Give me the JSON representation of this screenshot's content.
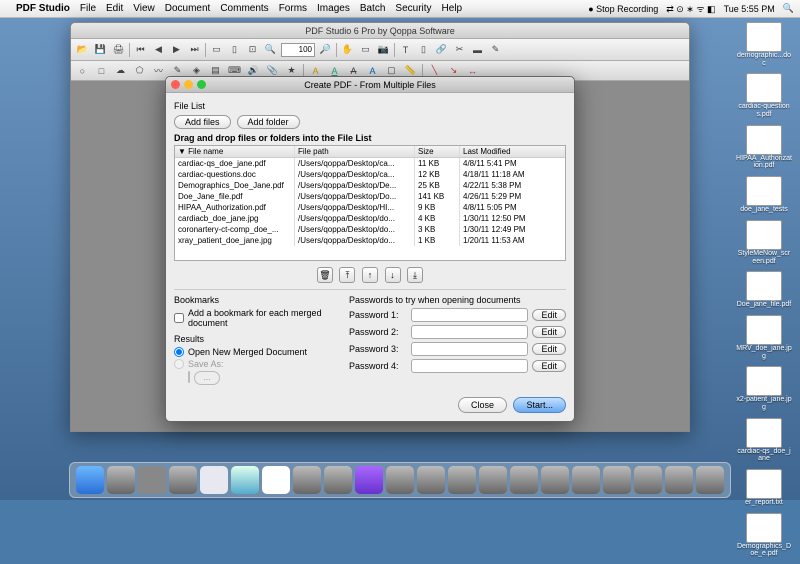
{
  "menubar": {
    "apple": "",
    "app": "PDF Studio",
    "items": [
      "File",
      "Edit",
      "View",
      "Document",
      "Comments",
      "Forms",
      "Images",
      "Batch",
      "Security",
      "Help"
    ],
    "stop_recording": "Stop Recording",
    "time": "Tue 5:55 PM"
  },
  "appwin": {
    "title": "PDF Studio 6 Pro by Qoppa Software",
    "zoom": "100"
  },
  "dialog": {
    "title": "Create PDF - From Multiple Files",
    "file_list_label": "File List",
    "add_files": "Add files",
    "add_folder": "Add folder",
    "drag_hint": "Drag and drop files or folders into the File List",
    "cols": [
      "File name",
      "File path",
      "Size",
      "Last Modified"
    ],
    "rows": [
      {
        "name": "cardiac-qs_doe_jane.pdf",
        "path": "/Users/qoppa/Desktop/ca...",
        "size": "11 KB",
        "mod": "4/8/11 5:41 PM"
      },
      {
        "name": "cardiac-questions.doc",
        "path": "/Users/qoppa/Desktop/ca...",
        "size": "12 KB",
        "mod": "4/18/11 11:18 AM"
      },
      {
        "name": "Demographics_Doe_Jane.pdf",
        "path": "/Users/qoppa/Desktop/De...",
        "size": "25 KB",
        "mod": "4/22/11 5:38 PM"
      },
      {
        "name": "Doe_Jane_file.pdf",
        "path": "/Users/qoppa/Desktop/Do...",
        "size": "141 KB",
        "mod": "4/26/11 5:29 PM"
      },
      {
        "name": "HIPAA_Authorization.pdf",
        "path": "/Users/qoppa/Desktop/HI...",
        "size": "9 KB",
        "mod": "4/8/11 5:05 PM"
      },
      {
        "name": "cardiacb_doe_jane.jpg",
        "path": "/Users/qoppa/Desktop/do...",
        "size": "4 KB",
        "mod": "1/30/11 12:50 PM"
      },
      {
        "name": "coronartery-ct-comp_doe_...",
        "path": "/Users/qoppa/Desktop/do...",
        "size": "3 KB",
        "mod": "1/30/11 12:49 PM"
      },
      {
        "name": "xray_patient_doe_jane.jpg",
        "path": "/Users/qoppa/Desktop/do...",
        "size": "1 KB",
        "mod": "1/20/11 11:53 AM"
      }
    ],
    "bookmarks_label": "Bookmarks",
    "bookmark_cb": "Add a bookmark for each merged document",
    "results_label": "Results",
    "open_new": "Open New Merged Document",
    "save_as": "Save As:",
    "passwords_label": "Passwords to try when opening documents",
    "pw": [
      "Password 1:",
      "Password 2:",
      "Password 3:",
      "Password 4:"
    ],
    "edit": "Edit",
    "close": "Close",
    "start": "Start..."
  },
  "desktop_icons": [
    "demographic...doc",
    "cardiac-questions.pdf",
    "HIPAA_Authorization.pdf",
    "doe_jane_tests",
    "StyleMeNow_screen.pdf",
    "Doe_jane_file.pdf",
    "MRV_doe_jane.jpg",
    "x2-patient_jane.jpg",
    "cardiac-qs_doe_jane",
    "er_report.txt",
    "Demographics_Doe_e.pdf"
  ]
}
